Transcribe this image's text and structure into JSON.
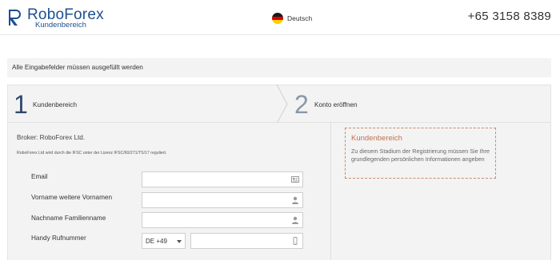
{
  "header": {
    "logo_name": "RoboForex",
    "logo_sub": "Kundenbereich",
    "language_label": "Deutsch",
    "phone": "+65 3158 8389"
  },
  "notice": "Alle Eingabefelder müssen ausgefüllt werden",
  "steps": [
    {
      "number": "1",
      "label": "Kundenbereich"
    },
    {
      "number": "2",
      "label": "Konto eröffnen"
    }
  ],
  "broker": {
    "title": "Broker: RoboForex Ltd.",
    "regulation": "RoboForex Ltd wird durch die IFSC unter der Lizenz IFSC/60/271/TS/17 reguliert."
  },
  "form": {
    "email_label": "Email",
    "firstname_label": "Vorname weitere Vornamen",
    "lastname_label": "Nachname Familienname",
    "mobile_label": "Handy Rufnummer",
    "country_code": "DE +49",
    "email_value": "",
    "firstname_value": "",
    "lastname_value": "",
    "mobile_value": ""
  },
  "info": {
    "title": "Kundenbereich",
    "text": "Zu diesem Stadium der Registrierung müssen Sie Ihre grundlegenden persönlichen Informationen angeben"
  },
  "colors": {
    "brand": "#1d4f91",
    "info_accent": "#c0714d",
    "panel_bg": "#f3f3f3"
  },
  "icons": {
    "email_field": "contact-card-icon",
    "name_fields": "person-icon",
    "mobile_field": "mobile-phone-icon",
    "language": "german-flag-icon"
  }
}
